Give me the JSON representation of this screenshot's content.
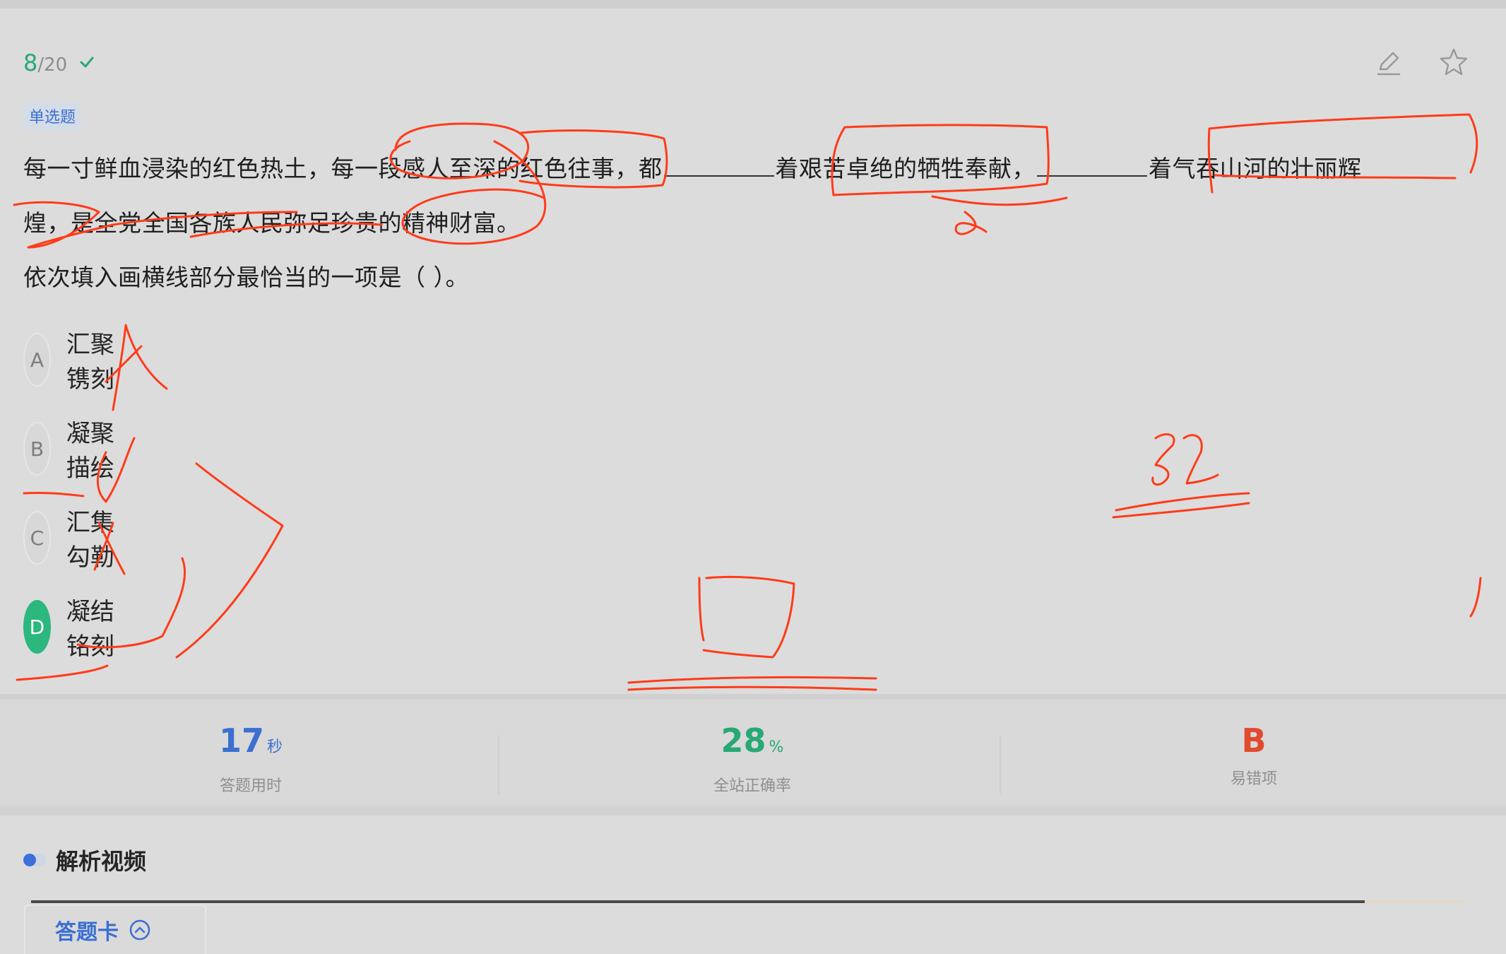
{
  "progress": {
    "current": "8",
    "separator": "/",
    "total": "20"
  },
  "toolbar": {
    "edit_icon": "pencil-icon",
    "favorite_icon": "star-icon"
  },
  "question": {
    "type_label": "单选题",
    "stem_line1_part1": "每一寸鲜血浸染的红色热土，每一段感人至深的红色往事，都",
    "stem_line1_part2": "着艰苦卓绝的牺牲奉献，",
    "stem_line1_part3": "着气吞山河的壮丽辉",
    "stem_line2": "煌，是全党全国各族人民弥足珍贵的精神财富。",
    "prompt": "依次填入画横线部分最恰当的一项是（    ）。"
  },
  "options": [
    {
      "letter": "A",
      "text": "汇聚 镌刻",
      "selected": false
    },
    {
      "letter": "B",
      "text": "凝聚 描绘",
      "selected": false
    },
    {
      "letter": "C",
      "text": "汇集 勾勒",
      "selected": false
    },
    {
      "letter": "D",
      "text": "凝结 铭刻",
      "selected": true
    }
  ],
  "stats": {
    "time_value": "17",
    "time_unit": "秒",
    "time_label": "答题用时",
    "accuracy_value": "28",
    "accuracy_unit": "%",
    "accuracy_label": "全站正确率",
    "error_value": "B",
    "error_label": "易错项"
  },
  "video": {
    "section_title": "解析视频",
    "progress_fraction": 0.93
  },
  "answer_card": {
    "label": "答题卡"
  },
  "colors": {
    "accent_green": "#27a974",
    "accent_blue": "#3b6fd2",
    "error_red": "#e04a2f",
    "ink_red": "#ff3b1a"
  }
}
